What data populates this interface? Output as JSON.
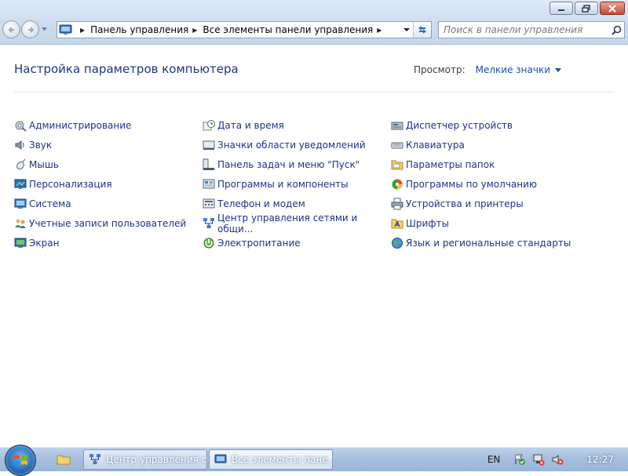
{
  "address": {
    "crumbs": [
      "Панель управления",
      "Все элементы панели управления"
    ]
  },
  "search": {
    "placeholder": "Поиск в панели управления"
  },
  "header": {
    "title": "Настройка параметров компьютера",
    "view_label": "Просмотр:",
    "view_value": "Мелкие значки"
  },
  "items": {
    "col1": [
      {
        "label": "Администрирование",
        "icon": "admin-tools-icon"
      },
      {
        "label": "Звук",
        "icon": "speaker-icon"
      },
      {
        "label": "Мышь",
        "icon": "mouse-icon"
      },
      {
        "label": "Персонализация",
        "icon": "personalization-icon"
      },
      {
        "label": "Система",
        "icon": "system-icon"
      },
      {
        "label": "Учетные записи пользователей",
        "icon": "users-icon"
      },
      {
        "label": "Экран",
        "icon": "display-icon"
      }
    ],
    "col2": [
      {
        "label": "Дата и время",
        "icon": "clock-icon"
      },
      {
        "label": "Значки области уведомлений",
        "icon": "notification-icon"
      },
      {
        "label": "Панель задач и меню \"Пуск\"",
        "icon": "taskbar-icon"
      },
      {
        "label": "Программы и компоненты",
        "icon": "programs-icon"
      },
      {
        "label": "Телефон и модем",
        "icon": "phone-icon"
      },
      {
        "label": "Центр управления сетями и общи...",
        "icon": "network-icon"
      },
      {
        "label": "Электропитание",
        "icon": "power-icon"
      }
    ],
    "col3": [
      {
        "label": "Диспетчер устройств",
        "icon": "device-manager-icon"
      },
      {
        "label": "Клавиатура",
        "icon": "keyboard-icon"
      },
      {
        "label": "Параметры папок",
        "icon": "folder-options-icon"
      },
      {
        "label": "Программы по умолчанию",
        "icon": "default-programs-icon"
      },
      {
        "label": "Устройства и принтеры",
        "icon": "printer-icon"
      },
      {
        "label": "Шрифты",
        "icon": "fonts-icon"
      },
      {
        "label": "Язык и региональные стандарты",
        "icon": "globe-icon"
      }
    ]
  },
  "taskbar": {
    "buttons": [
      {
        "label": "Центр управления с...",
        "icon": "network-icon"
      },
      {
        "label": "Все элементы пане...",
        "icon": "control-panel-icon"
      }
    ],
    "lang": "EN",
    "clock": "12:27"
  }
}
